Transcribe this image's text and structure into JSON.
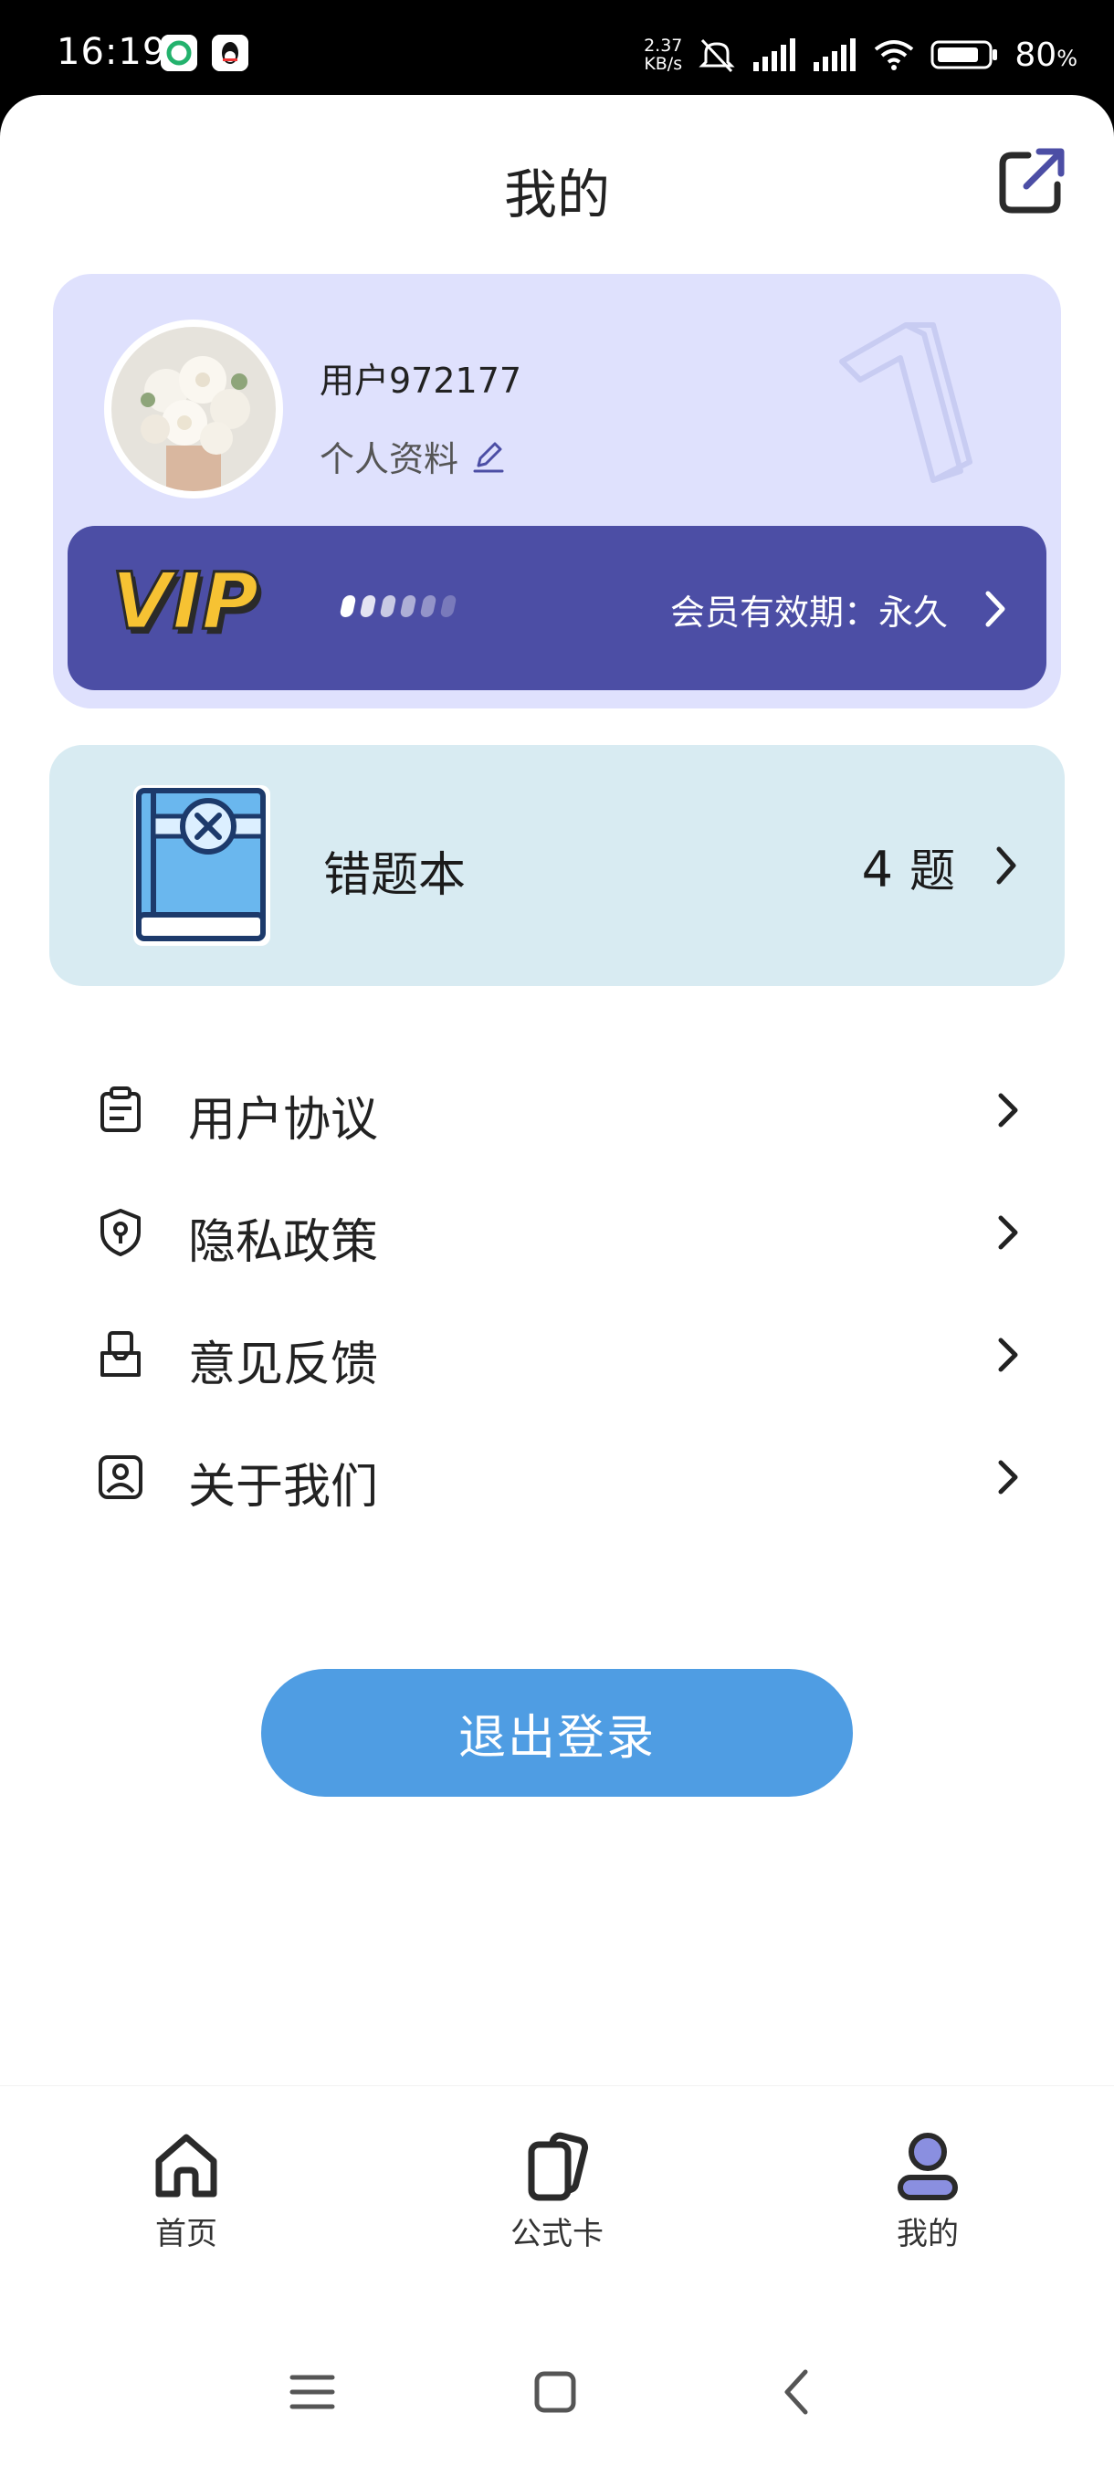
{
  "status_bar": {
    "time": "16:19",
    "speed_value": "2.37",
    "speed_unit": "KB/s",
    "battery_percent": "80",
    "battery_unit": "%"
  },
  "header": {
    "title": "我的",
    "share_icon": "share-out-icon"
  },
  "profile": {
    "username": "用户972177",
    "profile_link": "个人资料",
    "edit_icon": "pencil-icon",
    "avatar": "flower-bouquet-avatar"
  },
  "vip": {
    "badge_text": "VIP",
    "validity_text": "会员有效期：永久",
    "accent_color": "#4c4ea5"
  },
  "wrong_book": {
    "title": "错题本",
    "count": "4",
    "unit": "题",
    "icon": "book-wrong-icon"
  },
  "menu": [
    {
      "label": "用户协议",
      "icon": "document-icon"
    },
    {
      "label": "隐私政策",
      "icon": "shield-key-icon"
    },
    {
      "label": "意见反馈",
      "icon": "feedback-mail-icon"
    },
    {
      "label": "关于我们",
      "icon": "contact-icon"
    }
  ],
  "logout": {
    "label": "退出登录",
    "color": "#4f9de3"
  },
  "bottom_nav": [
    {
      "label": "首页",
      "icon": "home-icon"
    },
    {
      "label": "公式卡",
      "icon": "cards-icon"
    },
    {
      "label": "我的",
      "icon": "user-icon",
      "active": true
    }
  ]
}
